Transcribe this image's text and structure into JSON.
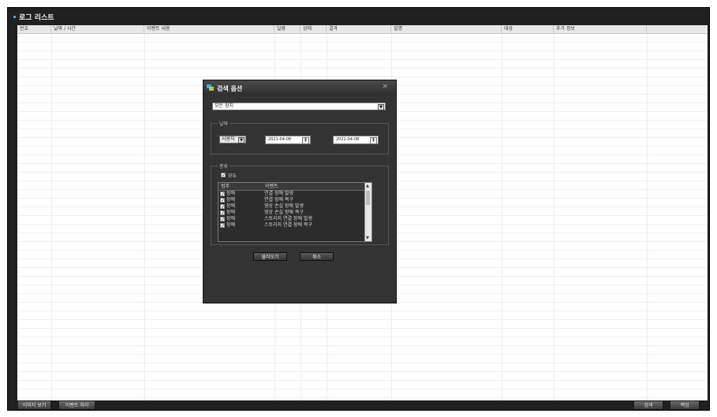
{
  "panel": {
    "title": "로그 리스트"
  },
  "table": {
    "columns": [
      "번호",
      "날짜 / 시간",
      "이벤트 내용",
      "일람",
      "상태",
      "결과",
      "설명",
      "대상",
      "추가 정보"
    ]
  },
  "footer": {
    "left_buttons": [
      "이미지 보기",
      "이벤트 처리"
    ],
    "right_buttons": [
      "검색",
      "백업"
    ]
  },
  "dialog": {
    "title": "검색 옵션",
    "close_glyph": "×",
    "device_select": "모든 장치",
    "date_group": {
      "legend": "날짜",
      "mode": "사용자",
      "start_date": "2021-04-08",
      "end_date": "2021-04-08"
    },
    "event_group": {
      "legend": "종류",
      "all_label": "모두",
      "columns": [
        "범주",
        "이벤트"
      ],
      "rows": [
        {
          "category": "장애",
          "event": "연결 장애 발생",
          "checked": true
        },
        {
          "category": "장애",
          "event": "연결 장애 복구",
          "checked": true
        },
        {
          "category": "장애",
          "event": "영상 손실 장애 발생",
          "checked": true
        },
        {
          "category": "장애",
          "event": "영상 손실 장애 복구",
          "checked": true
        },
        {
          "category": "장애",
          "event": "스토리지 연결 장애 발생",
          "checked": true
        },
        {
          "category": "장애",
          "event": "스토리지 연결 장애 복구",
          "checked": true
        }
      ]
    },
    "buttons": {
      "load": "불러오기",
      "cancel": "취소"
    }
  },
  "colors": {
    "frame": "#202020",
    "dialog": "#333333",
    "accent": "#5aa2e0"
  },
  "icons": [
    "search-options-icon",
    "close-icon",
    "dropdown-arrow-icon",
    "spin-icon",
    "checkbox-icon"
  ]
}
